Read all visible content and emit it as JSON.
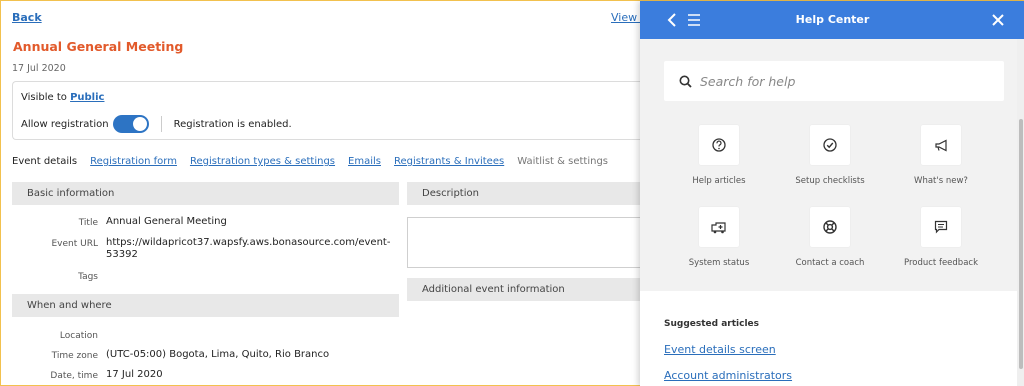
{
  "page": {
    "back_label": "Back",
    "view_link": "View e",
    "event_title": "Annual General Meeting",
    "event_date": "17 Jul 2020",
    "visibility": {
      "prefix": "Visible to",
      "value": "Public"
    },
    "registration": {
      "label": "Allow registration",
      "toggle_on": true,
      "status": "Registration is enabled."
    },
    "tabs": [
      {
        "label": "Event details",
        "state": "active"
      },
      {
        "label": "Registration form",
        "state": "link"
      },
      {
        "label": "Registration types & settings",
        "state": "link"
      },
      {
        "label": "Emails",
        "state": "link"
      },
      {
        "label": "Registrants & Invitees",
        "state": "link"
      },
      {
        "label": "Waitlist & settings",
        "state": "plain"
      }
    ],
    "basic_info": {
      "heading": "Basic information",
      "title_label": "Title",
      "title_value": "Annual General Meeting",
      "url_label": "Event URL",
      "url_value_line1": "https://wildapricot37.wapsfy.aws.bonasource.com/event-",
      "url_value_line2": "53392",
      "tags_label": "Tags"
    },
    "when_where": {
      "heading": "When and where",
      "location_label": "Location",
      "timezone_label": "Time zone",
      "timezone_value": "(UTC-05:00) Bogota, Lima, Quito, Rio Branco",
      "datetime_label": "Date, time",
      "datetime_value": "17 Jul 2020"
    },
    "description": {
      "heading": "Description"
    },
    "additional": {
      "heading": "Additional event information"
    }
  },
  "help_center": {
    "title": "Help Center",
    "search_placeholder": "Search for help",
    "tiles": [
      {
        "label": "Help articles",
        "icon": "question-circle-icon"
      },
      {
        "label": "Setup checklists",
        "icon": "check-circle-icon"
      },
      {
        "label": "What's new?",
        "icon": "megaphone-icon"
      },
      {
        "label": "System status",
        "icon": "ambulance-icon"
      },
      {
        "label": "Contact a coach",
        "icon": "lifebuoy-icon"
      },
      {
        "label": "Product feedback",
        "icon": "chat-bubble-icon"
      }
    ],
    "suggested_title": "Suggested articles",
    "suggested_articles": [
      "Event details screen",
      "Account administrators"
    ]
  },
  "colors": {
    "accent": "#3b7ddd",
    "title_orange": "#e25a2b",
    "link_blue": "#2a6ebb",
    "toggle_blue": "#2d74c4"
  }
}
